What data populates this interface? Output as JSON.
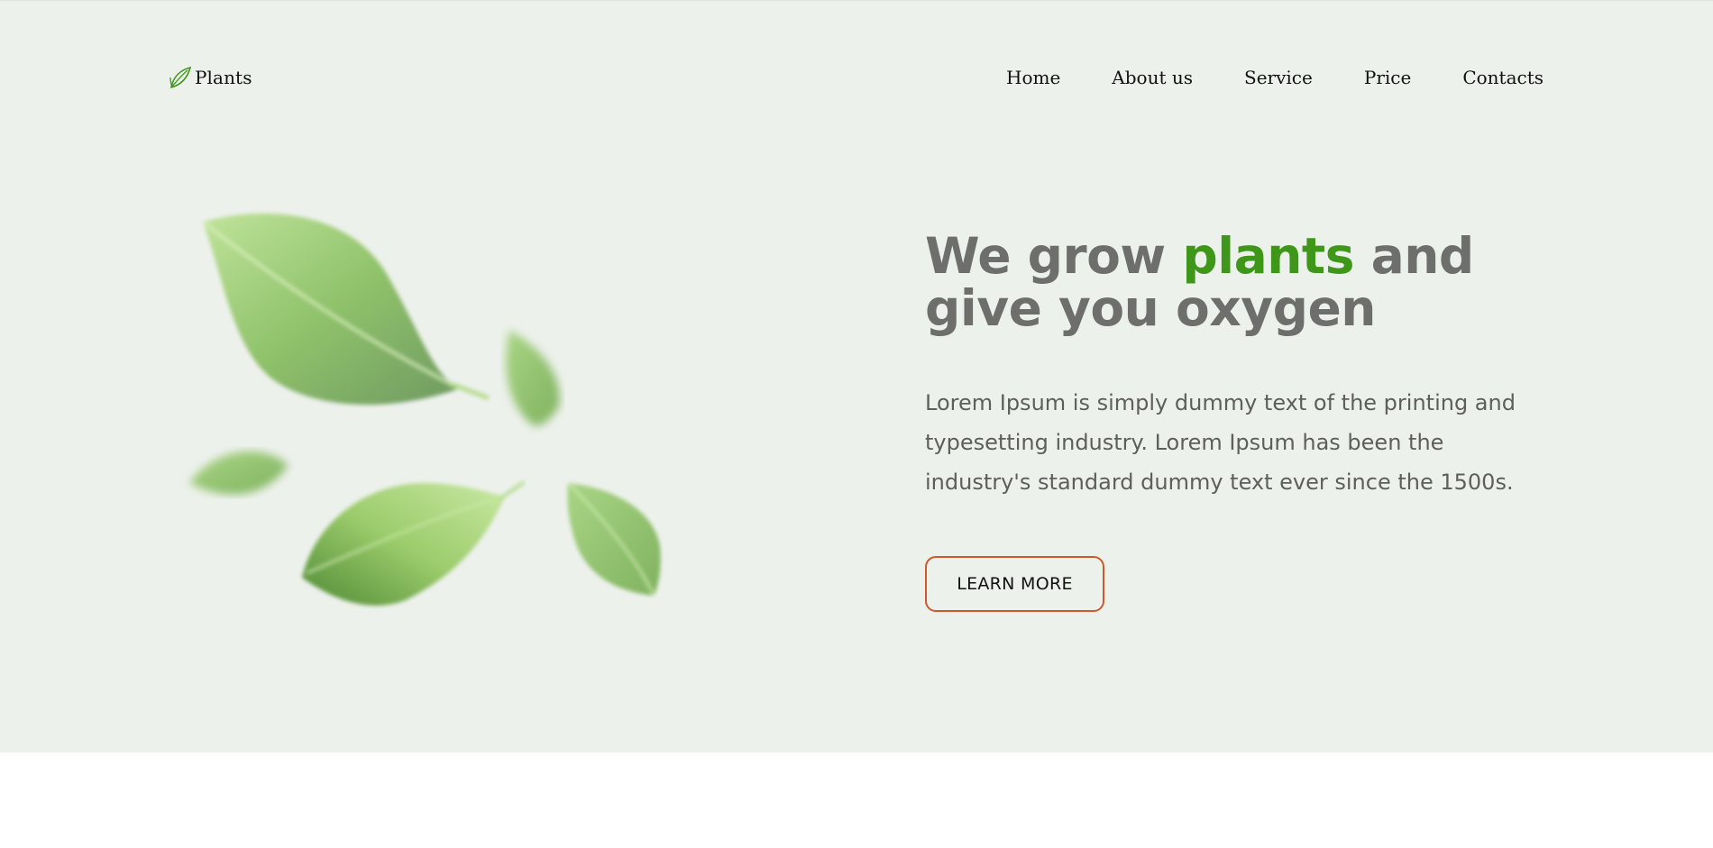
{
  "brand": {
    "name": "Plants",
    "icon": "leaf-icon"
  },
  "nav": {
    "items": [
      "Home",
      "About us",
      "Service",
      "Price",
      "Contacts"
    ]
  },
  "hero": {
    "title_start": "We grow ",
    "title_accent": "plants",
    "title_end": " and give you oxygen",
    "description": "Lorem Ipsum is simply dummy text of the printing and typesetting industry. Lorem Ipsum has been the industry's standard dummy text ever since the 1500s.",
    "cta_label": "LEARN MORE",
    "illustration": "falling-leaves"
  },
  "colors": {
    "hero_bg": "#edf1ec",
    "accent_green": "#3f9719",
    "heading_gray": "#6e6e6c",
    "button_border": "#d0582b"
  }
}
